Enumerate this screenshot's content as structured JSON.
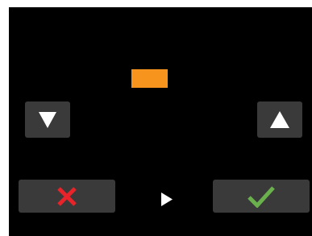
{
  "value_indicator": {
    "icon": "orange-rectangle-indicator",
    "color": "#f7941d"
  },
  "controls": {
    "decrease": {
      "icon": "triangle-down-icon",
      "color": "#ffffff"
    },
    "increase": {
      "icon": "triangle-up-icon",
      "color": "#ffffff"
    },
    "cancel": {
      "icon": "close-x-icon",
      "color": "#e8232a"
    },
    "confirm": {
      "icon": "check-icon",
      "color": "#6ab04c"
    },
    "play": {
      "icon": "play-icon",
      "color": "#ffffff"
    }
  },
  "colors": {
    "screen_background": "#000000",
    "button_background": "#3a3a3a"
  }
}
